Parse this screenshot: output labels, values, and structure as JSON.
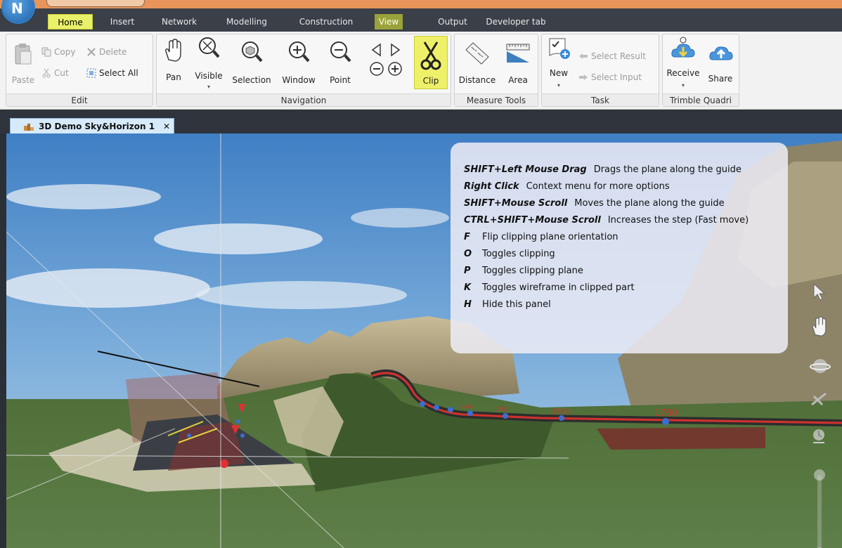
{
  "ribbon_tabs": [
    "Home",
    "Insert",
    "Network",
    "Modelling",
    "Construction",
    "View",
    "Output",
    "Developer tab"
  ],
  "groups": {
    "edit": {
      "label": "Edit",
      "paste": "Paste",
      "copy": "Copy",
      "cut": "Cut",
      "delete": "Delete",
      "select_all": "Select All"
    },
    "navigation": {
      "label": "Navigation",
      "pan": "Pan",
      "visible": "Visible",
      "selection": "Selection",
      "window": "Window",
      "point": "Point",
      "clip": "Clip"
    },
    "measure": {
      "label": "Measure Tools",
      "distance": "Distance",
      "area": "Area"
    },
    "task": {
      "label": "Task",
      "new": "New",
      "select_result": "Select Result",
      "select_input": "Select Input"
    },
    "trimble": {
      "label": "Trimble Quadri",
      "receive": "Receive",
      "share": "Share"
    }
  },
  "document_tab": {
    "title": "3D Demo Sky&Horizon 1",
    "close": "✕"
  },
  "help_panel": [
    {
      "key": "SHIFT+Left Mouse Drag",
      "desc": "Drags the plane along the guide"
    },
    {
      "key": "Right Click",
      "desc": "Context menu for more options"
    },
    {
      "key": "SHIFT+Mouse Scroll",
      "desc": "Moves the plane along the guide"
    },
    {
      "key": "CTRL+SHIFT+Mouse Scroll",
      "desc": "Increases the step (Fast move)"
    },
    {
      "key": "F",
      "desc": "Flip clipping plane orientation"
    },
    {
      "key": "O",
      "desc": "Toggles clipping"
    },
    {
      "key": "P",
      "desc": "Toggles clipping plane"
    },
    {
      "key": "K",
      "desc": "Toggles wireframe in clipped part"
    },
    {
      "key": "H",
      "desc": "Hide this panel"
    }
  ],
  "scene_labels": {
    "station_1": "1760",
    "station_2": "1780",
    "station_3": "1800",
    "station_4": "1820"
  },
  "app_logo_letter": "N",
  "colors": {
    "highlight": "#eef06a",
    "road_red": "#d2322d",
    "terrain": "#4c6a36",
    "sky": "#4a86c8"
  }
}
